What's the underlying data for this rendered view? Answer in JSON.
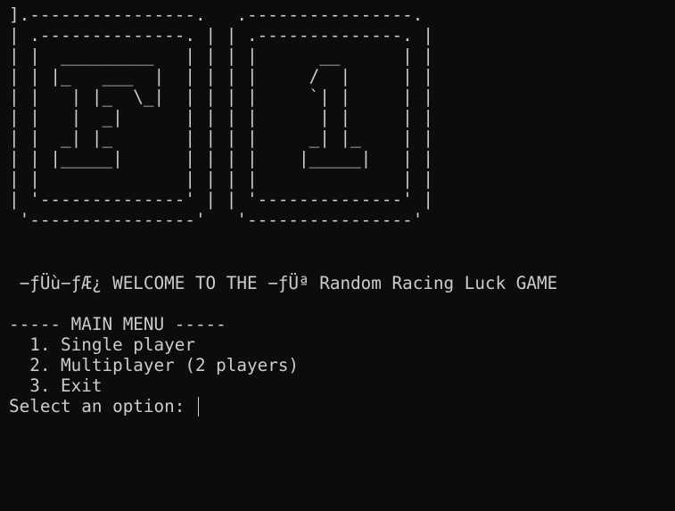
{
  "theme": {
    "background": "#0c0c0c",
    "foreground": "#cccccc"
  },
  "banner": {
    "lines": [
      "].----------------.   .----------------.",
      "| .--------------. | | .--------------. |",
      "| |  _________   | | | |      __      | |",
      "| | |_   ___  |  | | | |     /  |     | |",
      "| |   | |_  \\_|  | | | |     `| |     | |",
      "| |   |  _|      | | | |      | |     | |",
      "| |  _| |_       | | | |     _| |_    | |",
      "| | |_____|      | | | |    |_____|   | |",
      "| |              | | | |              | |",
      "| '--------------' | | '--------------' |",
      " '----------------'   '----------------'"
    ]
  },
  "blank_lines": [
    "",
    ""
  ],
  "welcome": " −ƒÜù−ƒÆ¿ WELCOME TO THE −ƒÜª Random Racing Luck GAME",
  "menu": {
    "header": "----- MAIN MENU -----",
    "options": [
      "  1. Single player",
      "  2. Multiplayer (2 players)",
      "  3. Exit"
    ]
  },
  "prompt": {
    "label": "Select an option: ",
    "value": ""
  }
}
